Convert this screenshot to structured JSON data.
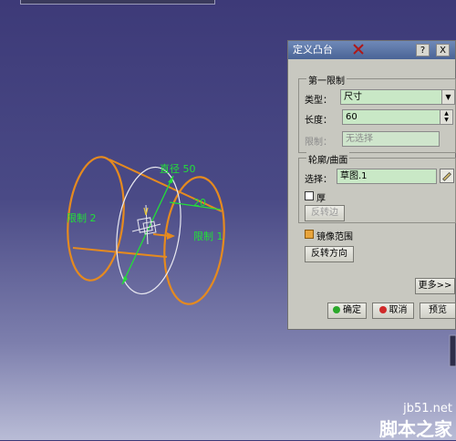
{
  "viewport": {
    "labels": {
      "diameter": "直径 50",
      "length": "20",
      "limit2": "限制 2",
      "limit1": "限制 1"
    },
    "colors": {
      "profile": "#e58a1f",
      "label_green": "#22e038",
      "circle": "#e8e8f0"
    }
  },
  "dialog": {
    "title": "定义凸台",
    "help_btn": "?",
    "close_btn": "X",
    "first_limit": {
      "group_label": "第一限制",
      "type_label": "类型：",
      "type_value": "尺寸",
      "length_label": "长度：",
      "length_value": "60",
      "limit_label": "限制：",
      "limit_value": "无选择"
    },
    "profile": {
      "group_label": "轮廓/曲面",
      "select_label": "选择：",
      "select_value": "草图.1",
      "thick_label": "厚",
      "reverse_side_btn": "反转边"
    },
    "mirror_label": "镜像范围",
    "reverse_dir_btn": "反转方向",
    "more_btn": "更多>>",
    "ok_btn": "确定",
    "cancel_btn": "取消",
    "preview_btn": "预览",
    "colors": {
      "ok_dot": "#2aa82a",
      "cancel_dot": "#d02a2a",
      "field_bg": "#c9e8c6"
    }
  },
  "watermark": {
    "url": "jb51.net",
    "name": "脚本之家"
  }
}
